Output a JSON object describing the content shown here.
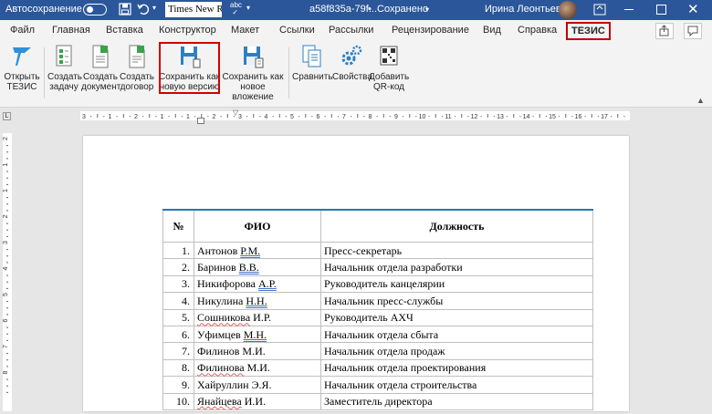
{
  "titlebar": {
    "autosave_label": "Автосохранение",
    "font_name": "Times New R",
    "doc_name": "a58f835a-79f...",
    "doc_separator": "•",
    "save_status": "Сохранено",
    "user_name": "Ирина Леонтьева"
  },
  "tabs": [
    "Файл",
    "Главная",
    "Вставка",
    "Конструктор",
    "Макет",
    "Ссылки",
    "Рассылки",
    "Рецензирование",
    "Вид",
    "Справка",
    "ТЕЗИС"
  ],
  "ribbon": {
    "open": [
      "Открыть",
      "ТЕЗИС"
    ],
    "create_task": [
      "Создать",
      "задачу"
    ],
    "create_doc": [
      "Создать",
      "документ"
    ],
    "create_contract": [
      "Создать",
      "договор"
    ],
    "save_version": [
      "Сохранить как",
      "новую версию"
    ],
    "save_attachment": [
      "Сохранить как",
      "новое вложение"
    ],
    "compare": "Сравнить",
    "properties": "Свойства",
    "add_qr": [
      "Добавить",
      "QR-код"
    ]
  },
  "ruler": {
    "h_labels": [
      "3",
      "1",
      "2",
      "1",
      "1",
      "2",
      "3",
      "4",
      "5",
      "6",
      "7",
      "8",
      "9",
      "10",
      "11",
      "12",
      "13",
      "14",
      "15",
      "16",
      "17"
    ],
    "v_labels": [
      "2",
      "1",
      "1",
      "2",
      "3",
      "4",
      "5",
      "6",
      "7",
      "8"
    ]
  },
  "table": {
    "headers": [
      "№",
      "ФИО",
      "Должность"
    ],
    "rows": [
      {
        "num": "1.",
        "name": "Антонов Р.М.",
        "position": "Пресс-секретарь"
      },
      {
        "num": "2.",
        "name": "Баринов В.В.",
        "position": "Начальник отдела разработки"
      },
      {
        "num": "3.",
        "name": "Никифорова А.Р.",
        "position": "Руководитель канцелярии"
      },
      {
        "num": "4.",
        "name": "Никулина Н.Н.",
        "position": "Начальник пресс-службы"
      },
      {
        "num": "5.",
        "name": "Сошникова И.Р.",
        "position": "Руководитель АХЧ"
      },
      {
        "num": "6.",
        "name": "Уфимцев М.Н.",
        "position": "Начальник отдела сбыта"
      },
      {
        "num": "7.",
        "name": "Филинов М.И.",
        "position": "Начальник отдела продаж"
      },
      {
        "num": "8.",
        "name": "Филинова М.И.",
        "position": "Начальник отдела проектирования"
      },
      {
        "num": "9.",
        "name": "Хайруллин Э.Я.",
        "position": "Начальник отдела строительства"
      },
      {
        "num": "10.",
        "name": "Янайцева И.И.",
        "position": "Заместитель директора"
      }
    ]
  },
  "colors": {
    "titlebar": "#2b579a",
    "highlight": "#d00000",
    "table_top_border": "#2e74b5"
  }
}
